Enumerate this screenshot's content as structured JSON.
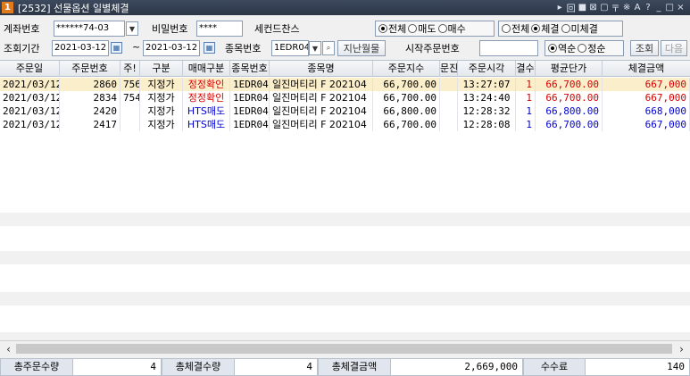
{
  "window": {
    "number": "1",
    "title": "[2532] 선물옵션 일별체결",
    "icons": [
      "▸",
      "回",
      "■",
      "⊠",
      "▢",
      "〒",
      "※",
      "A",
      "?",
      "_",
      "□",
      "×"
    ]
  },
  "filters": {
    "account_label": "계좌번호",
    "account_value": "******74-03",
    "password_label": "비밀번호",
    "password_value": "****",
    "company": "세컨드찬스",
    "side_options": [
      "전체",
      "매도",
      "매수"
    ],
    "side_selected": "전체",
    "status_options": [
      "전체",
      "체결",
      "미체결"
    ],
    "status_selected": "체결",
    "period_label": "조회기간",
    "date_from": "2021-03-12",
    "tilde": "~",
    "date_to": "2021-03-12",
    "code_label": "종목번호",
    "code_value": "1EDR04",
    "expired_button": "지난월물",
    "start_order_label": "시작주문번호",
    "start_order_value": "",
    "sort_options": [
      "역순",
      "정순"
    ],
    "sort_selected": "역순",
    "query_button": "조회",
    "next_button": "다음"
  },
  "table": {
    "columns": [
      "주문일",
      "주문번호",
      "주!",
      "구분",
      "매매구분",
      "종목번호",
      "종목명",
      "주문지수",
      "문진",
      "주문시각",
      "결수",
      "평균단가",
      "체결금액"
    ],
    "rows": [
      {
        "date": "2021/03/12",
        "order_no": "2860",
        "orig": "756",
        "type": "지정가",
        "trade": "정정확인",
        "trade_color": "red",
        "code": "1EDR04",
        "name": "일진머티리 F 202104",
        "price": "66,700.00",
        "ex": "",
        "time": "13:27:07",
        "qty": "1",
        "avg": "66,700.00",
        "avg_color": "red",
        "amount": "667,000",
        "amount_color": "red"
      },
      {
        "date": "2021/03/12",
        "order_no": "2834",
        "orig": "754",
        "type": "지정가",
        "trade": "정정확인",
        "trade_color": "red",
        "code": "1EDR04",
        "name": "일진머티리 F 202104",
        "price": "66,700.00",
        "ex": "",
        "time": "13:24:40",
        "qty": "1",
        "avg": "66,700.00",
        "avg_color": "red",
        "amount": "667,000",
        "amount_color": "red"
      },
      {
        "date": "2021/03/12",
        "order_no": "2420",
        "orig": "",
        "type": "지정가",
        "trade": "HTS매도",
        "trade_color": "blue",
        "code": "1EDR04",
        "name": "일진머티리 F 202104",
        "price": "66,800.00",
        "ex": "",
        "time": "12:28:32",
        "qty": "1",
        "avg": "66,800.00",
        "avg_color": "blue",
        "amount": "668,000",
        "amount_color": "blue"
      },
      {
        "date": "2021/03/12",
        "order_no": "2417",
        "orig": "",
        "type": "지정가",
        "trade": "HTS매도",
        "trade_color": "blue",
        "code": "1EDR04",
        "name": "일진머티리 F 202104",
        "price": "66,700.00",
        "ex": "",
        "time": "12:28:08",
        "qty": "1",
        "avg": "66,700.00",
        "avg_color": "blue",
        "amount": "667,000",
        "amount_color": "blue"
      }
    ]
  },
  "footer": {
    "total_order_qty_label": "총주문수량",
    "total_order_qty": "4",
    "total_exec_qty_label": "총체결수량",
    "total_exec_qty": "4",
    "total_exec_amount_label": "총체결금액",
    "total_exec_amount": "2,669,000",
    "fee_label": "수수료",
    "fee": "140"
  },
  "colors": {
    "selected_row": "#fbeecb",
    "sell_up": "#d40000",
    "sell_down": "#0000d0"
  }
}
